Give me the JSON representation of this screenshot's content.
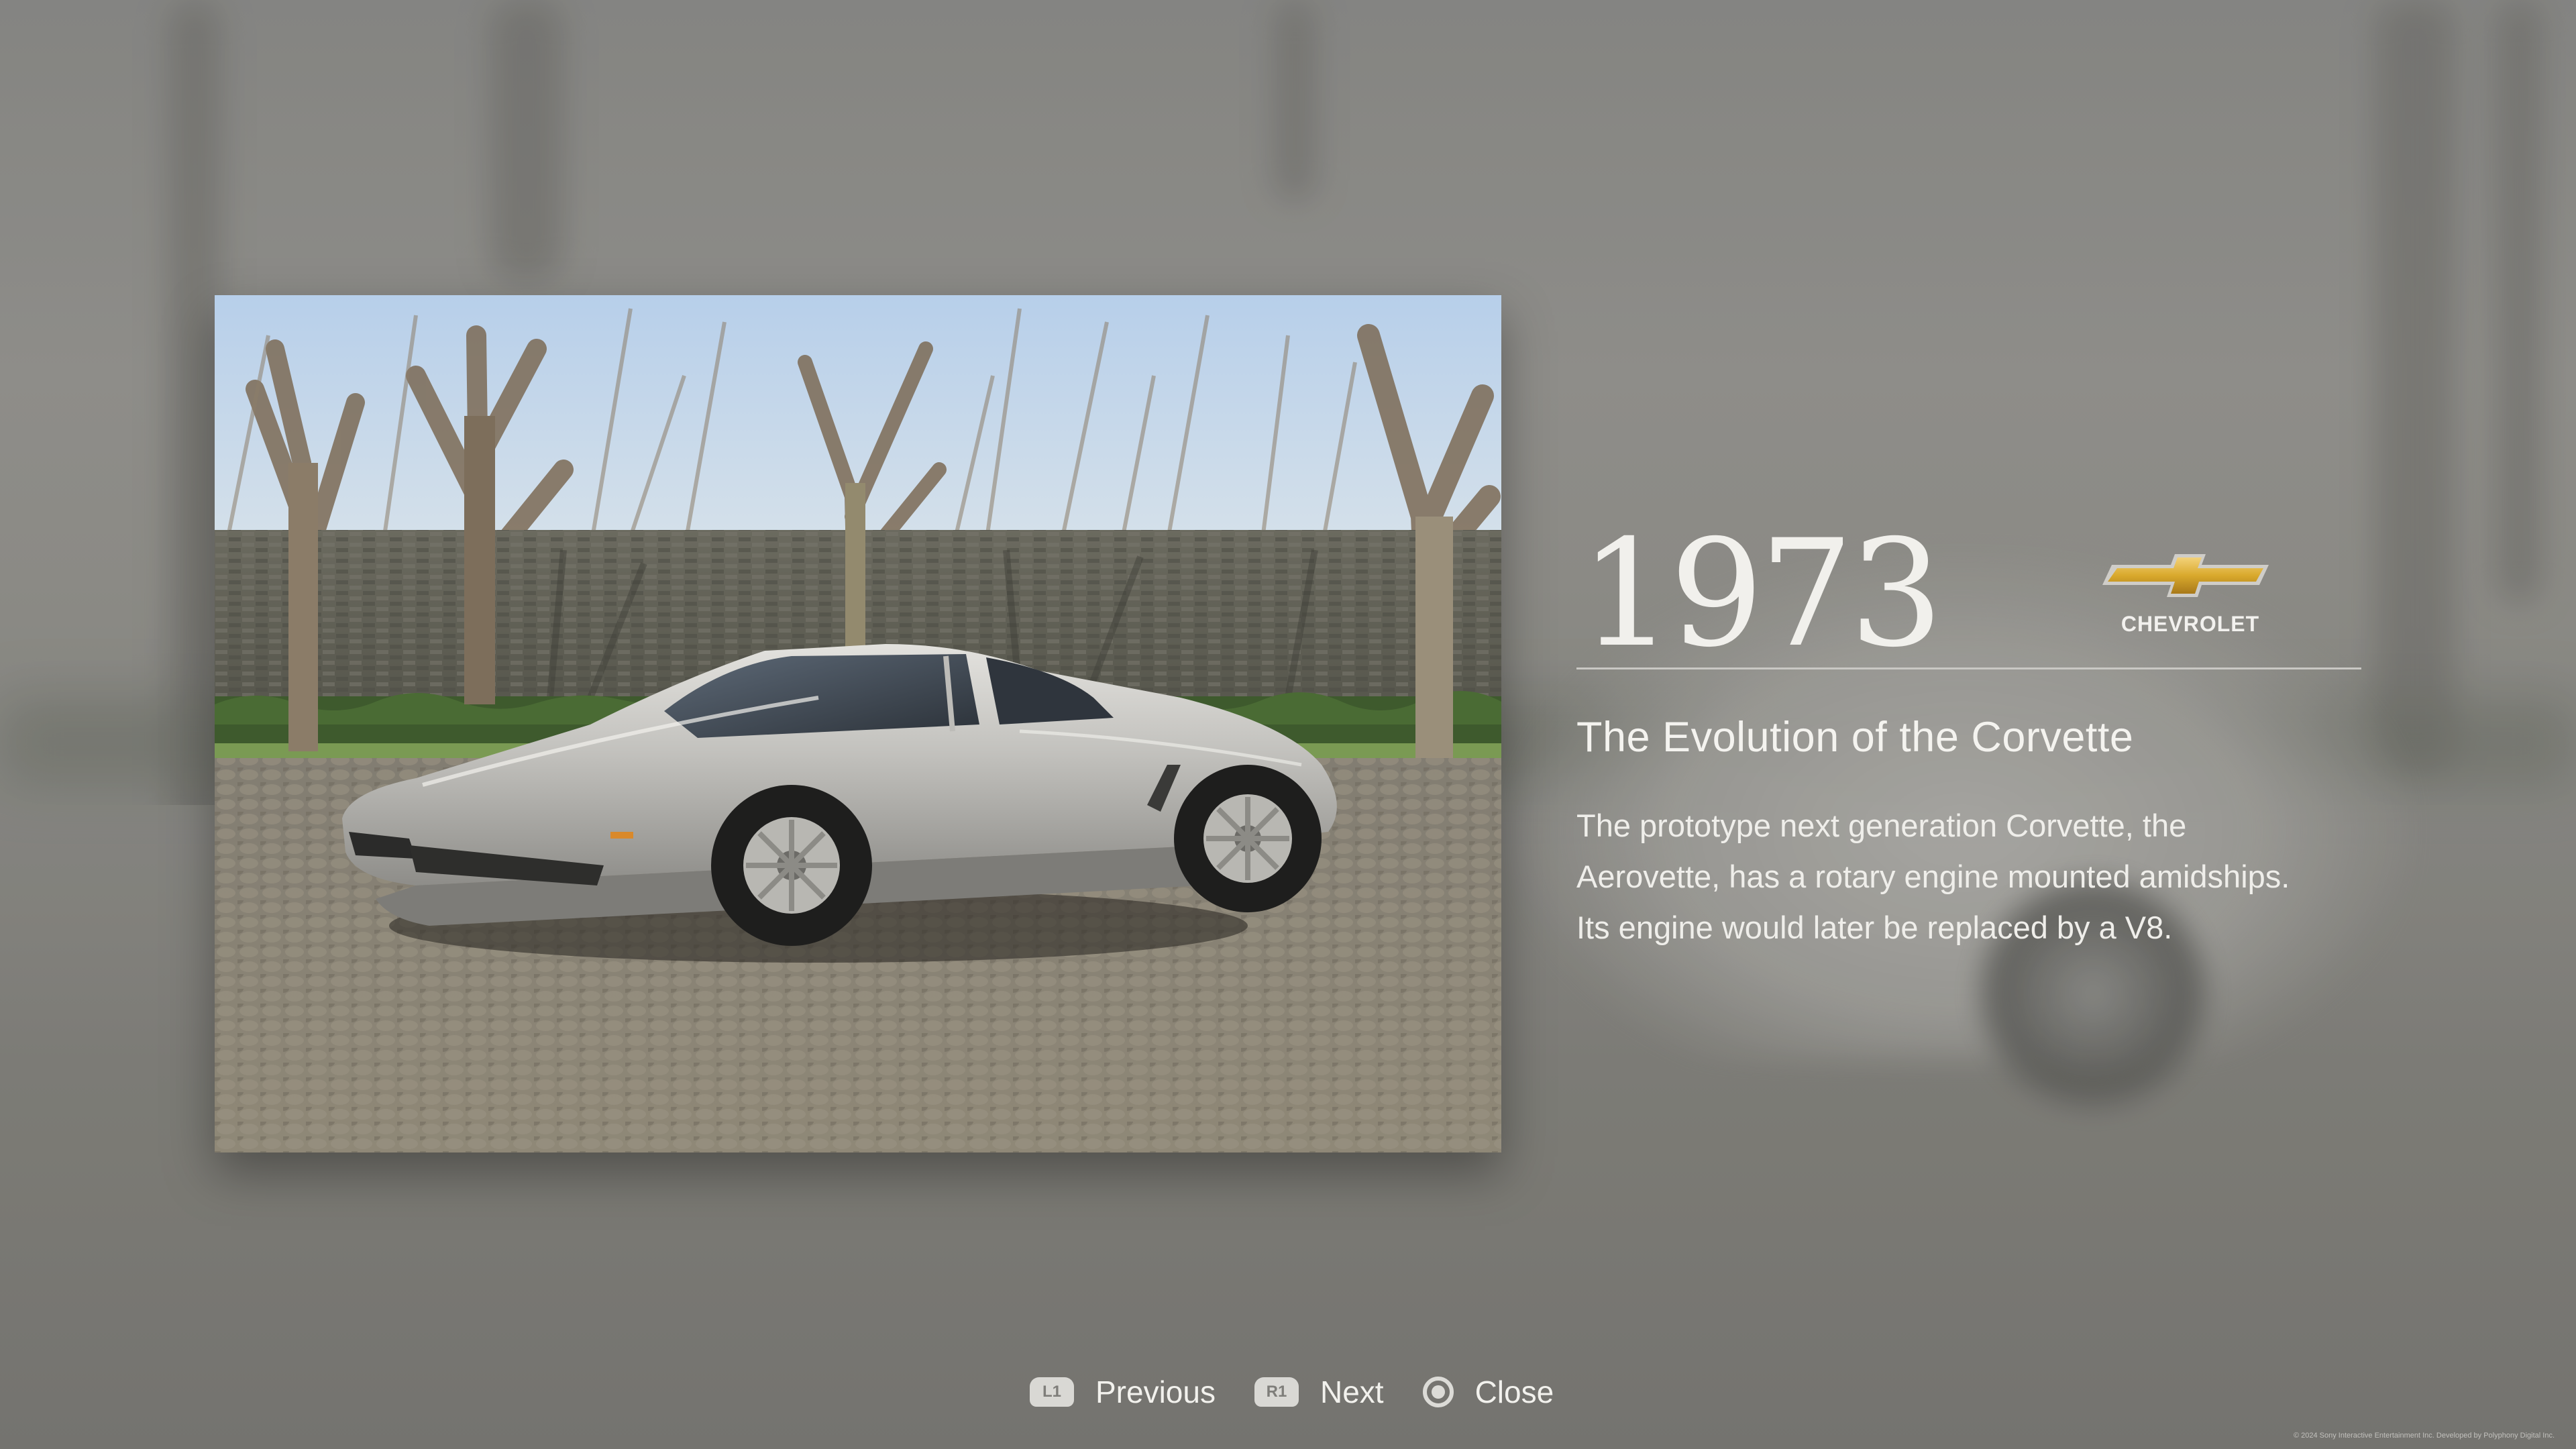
{
  "gallery_item": {
    "year": "1973",
    "brand": {
      "name": "CHEVROLET",
      "logo_icon": "chevrolet-bowtie-icon",
      "logo_color": "#d9a92c"
    },
    "title": "The Evolution of the Corvette",
    "description_lines": [
      "The prototype next generation Corvette, the",
      "Aerovette, has a rotary engine mounted amidships.",
      "Its engine would later be replaced by a V8."
    ],
    "photo": {
      "subject": "silver mid-engine prototype car on cobblestone in front of trees and brick wall"
    }
  },
  "controls": [
    {
      "badge": "L1",
      "label": "Previous"
    },
    {
      "badge": "R1",
      "label": "Next"
    },
    {
      "badge_icon": "circle-button-icon",
      "label": "Close"
    }
  ],
  "footer": {
    "copyright": "© 2024 Sony Interactive Entertainment Inc. Developed by Polyphony Digital Inc."
  }
}
